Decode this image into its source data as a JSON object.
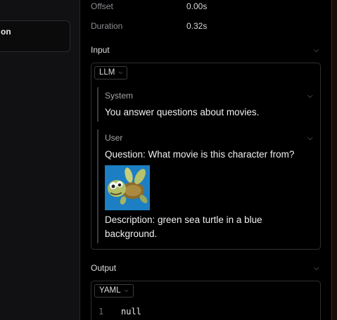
{
  "left_panel": {
    "card_text": "on"
  },
  "meta": {
    "offset_label": "Offset",
    "offset_value": "0.00s",
    "duration_label": "Duration",
    "duration_value": "0.32s"
  },
  "input": {
    "title": "Input",
    "format": "LLM",
    "messages": [
      {
        "role": "System",
        "text": "You answer questions about movies."
      },
      {
        "role": "User",
        "question": "Question: What movie is this character from?",
        "description": "Description: green sea turtle in a blue background."
      }
    ]
  },
  "output": {
    "title": "Output",
    "format": "YAML",
    "lines": [
      {
        "number": "1",
        "text": "null"
      }
    ]
  },
  "colors": {
    "background": "#000000",
    "panel": "#111113",
    "border": "#2f2f33",
    "muted": "#8d8d93",
    "image_bg": "#1c7fc4"
  }
}
